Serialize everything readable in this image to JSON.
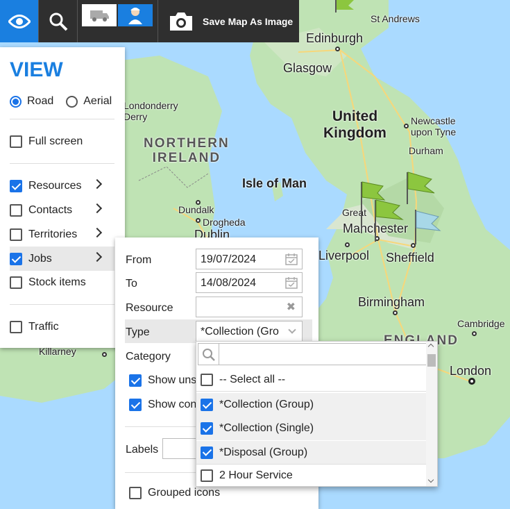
{
  "toolbar": {
    "save_label": "Save Map As Image"
  },
  "map": {
    "labels": {
      "st_andrews": "St Andrews",
      "edinburgh": "Edinburgh",
      "glasgow": "Glasgow",
      "londonderry": "Londonderry\nDerry",
      "northern_ireland": "NORTHERN\nIRELAND",
      "united_kingdom": "United\nKingdom",
      "newcastle": "Newcastle\nupon Tyne",
      "durham": "Durham",
      "isle_of_man": "Isle of Man",
      "dundalk": "Dundalk",
      "drogheda": "Drogheda",
      "dublin": "Dublin",
      "great": "Great",
      "manchester": "Manchester",
      "liverpool": "Liverpool",
      "sheffield": "Sheffield",
      "birmingham": "Birmingham",
      "cambridge": "Cambridge",
      "england": "ENGLAND",
      "london": "London",
      "killarney": "Killarney"
    }
  },
  "view_panel": {
    "title": "VIEW",
    "map_types": [
      {
        "label": "Road",
        "selected": true
      },
      {
        "label": "Aerial",
        "selected": false
      }
    ],
    "full_screen": {
      "label": "Full screen",
      "checked": false
    },
    "layers": [
      {
        "label": "Resources",
        "checked": true
      },
      {
        "label": "Contacts",
        "checked": false
      },
      {
        "label": "Territories",
        "checked": false
      },
      {
        "label": "Jobs",
        "checked": true
      },
      {
        "label": "Stock items",
        "checked": false
      }
    ],
    "traffic": {
      "label": "Traffic",
      "checked": false
    }
  },
  "jobs_panel": {
    "from_label": "From",
    "from_value": "19/07/2024",
    "to_label": "To",
    "to_value": "14/08/2024",
    "resource_label": "Resource",
    "resource_value": "",
    "type_label": "Type",
    "type_value": "*Collection (Gro",
    "category_label": "Category",
    "show_unscheduled": "Show uns",
    "show_completed": "Show con",
    "labels_label": "Labels",
    "grouped_icons": "Grouped icons"
  },
  "type_dropdown": {
    "search_placeholder": "",
    "items": [
      {
        "label": "-- Select all --",
        "checked": false
      },
      {
        "label": "*Collection (Group)",
        "checked": true
      },
      {
        "label": "*Collection (Single)",
        "checked": true
      },
      {
        "label": "*Disposal (Group)",
        "checked": true
      },
      {
        "label": "2 Hour Service",
        "checked": false
      }
    ]
  },
  "colors": {
    "accent": "#1a7fe0",
    "toolbar": "#2f2f2f",
    "sea": "#aadaff",
    "land": "#bfe3b4"
  }
}
